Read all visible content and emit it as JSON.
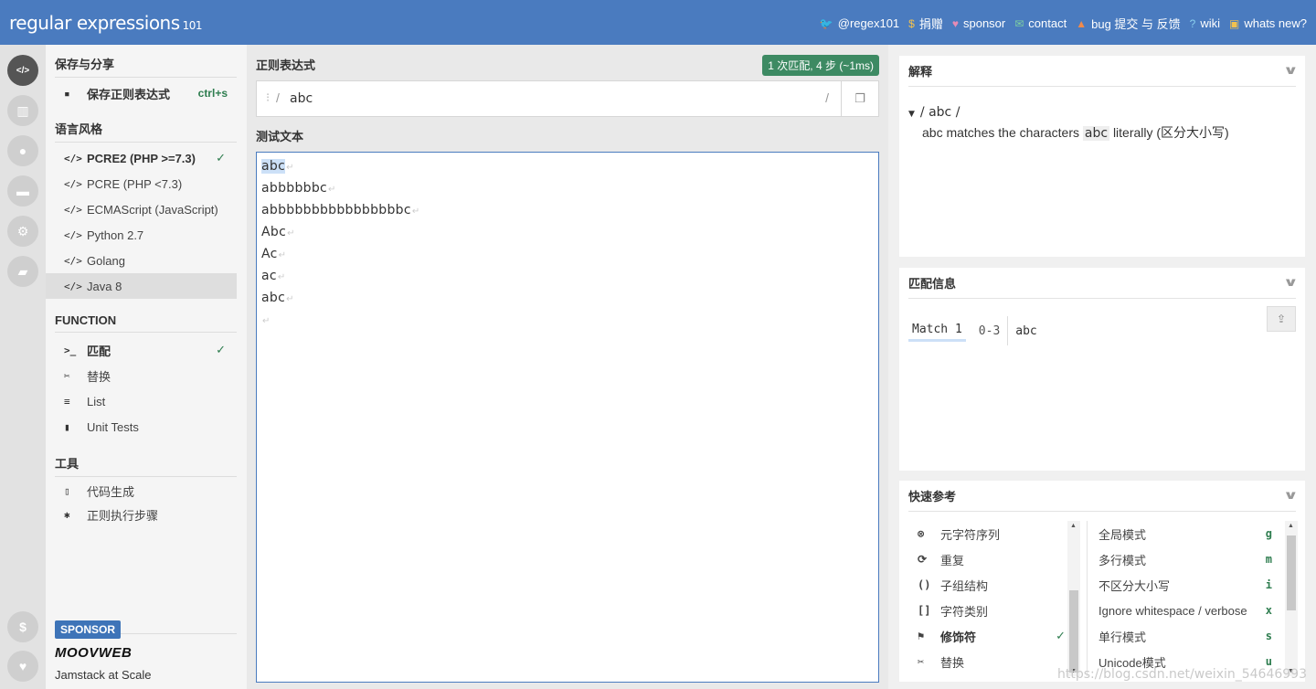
{
  "header": {
    "logo_text": "regular expressions",
    "logo_version": "101",
    "links": [
      {
        "icon": "twitter-icon",
        "glyph": "🐦",
        "label": "@regex101"
      },
      {
        "icon": "dollar-icon",
        "glyph": "$",
        "label": "捐赠"
      },
      {
        "icon": "heart-icon",
        "glyph": "♥",
        "label": "sponsor"
      },
      {
        "icon": "mail-icon",
        "glyph": "✉",
        "label": "contact"
      },
      {
        "icon": "warning-icon",
        "glyph": "▲",
        "label": "bug 提交 与 反馈"
      },
      {
        "icon": "help-icon",
        "glyph": "?",
        "label": "wiki"
      },
      {
        "icon": "gift-icon",
        "glyph": "▣",
        "label": "whats new?"
      }
    ]
  },
  "rail": [
    {
      "icon": "code-icon",
      "glyph": "</>"
    },
    {
      "icon": "library-icon",
      "glyph": "▥"
    },
    {
      "icon": "user-icon",
      "glyph": "●"
    },
    {
      "icon": "gamepad-icon",
      "glyph": "▬"
    },
    {
      "icon": "settings-icon",
      "glyph": "⚙"
    },
    {
      "icon": "chat-icon",
      "glyph": "▰"
    },
    {
      "icon": "dollar-icon",
      "glyph": "$"
    },
    {
      "icon": "heart-icon",
      "glyph": "♥"
    }
  ],
  "sidebar": {
    "save_title": "保存与分享",
    "save_item": {
      "icon": "▪",
      "label": "保存正则表达式",
      "shortcut": "ctrl+s"
    },
    "flavor_title": "语言风格",
    "flavors": [
      {
        "label": "PCRE2 (PHP >=7.3)",
        "check": "✓"
      },
      {
        "label": "PCRE (PHP <7.3)",
        "check": ""
      },
      {
        "label": "ECMAScript (JavaScript)",
        "check": ""
      },
      {
        "label": "Python 2.7",
        "check": ""
      },
      {
        "label": "Golang",
        "check": ""
      },
      {
        "label": "Java 8",
        "check": ""
      }
    ],
    "function_title": "FUNCTION",
    "functions": [
      {
        "icon": ">_",
        "label": "匹配",
        "check": "✓"
      },
      {
        "icon": "✂",
        "label": "替换",
        "check": ""
      },
      {
        "icon": "≡",
        "label": "List",
        "check": ""
      },
      {
        "icon": "▮",
        "label": "Unit Tests",
        "check": ""
      }
    ],
    "tools_title": "工具",
    "tools": [
      {
        "icon": "▯",
        "label": "代码生成"
      },
      {
        "icon": "✱",
        "label": "正则执行步骤"
      }
    ],
    "sponsor_badge": "SPONSOR",
    "sponsor_name": "MOOVWEB",
    "sponsor_tagline": "Jamstack at Scale"
  },
  "editor": {
    "regex_label": "正则表达式",
    "match_badge": "1 次匹配, 4 步 (~1ms)",
    "regex_value": "abc",
    "delimiter": "/",
    "test_label": "测试文本",
    "test_lines": [
      "abc",
      "abbbbbbc",
      "abbbbbbbbbbbbbbbbc",
      "Abc",
      "Ac",
      "ac",
      "abc",
      ""
    ],
    "newline_glyph": "↵"
  },
  "explanation": {
    "title": "解释",
    "line1": "/ abc /",
    "line2_code": "abc",
    "line2_pre": "matches the characters",
    "line2_code2": "abc",
    "line2_post": "literally (区分大小写)"
  },
  "match_info": {
    "title": "匹配信息",
    "name": "Match 1",
    "range": "0-3",
    "value": "abc"
  },
  "quick_ref": {
    "title": "快速参考",
    "left": [
      {
        "icon": "⊗",
        "label": "元字符序列",
        "check": ""
      },
      {
        "icon": "⟳",
        "label": "重复",
        "check": ""
      },
      {
        "icon": "()",
        "label": "子组结构",
        "check": ""
      },
      {
        "icon": "[]",
        "label": "字符类别",
        "check": ""
      },
      {
        "icon": "⚑",
        "label": "修饰符",
        "check": "✓"
      },
      {
        "icon": "✂",
        "label": "替换",
        "check": ""
      }
    ],
    "right": [
      {
        "label": "全局模式",
        "key": "g"
      },
      {
        "label": "多行模式",
        "key": "m"
      },
      {
        "label": "不区分大小写",
        "key": "i"
      },
      {
        "label": "Ignore whitespace / verbose",
        "key": "x"
      },
      {
        "label": "单行模式",
        "key": "s"
      },
      {
        "label": "Unicode模式",
        "key": "u"
      }
    ]
  },
  "watermark": "https://blog.csdn.net/weixin_54646993"
}
